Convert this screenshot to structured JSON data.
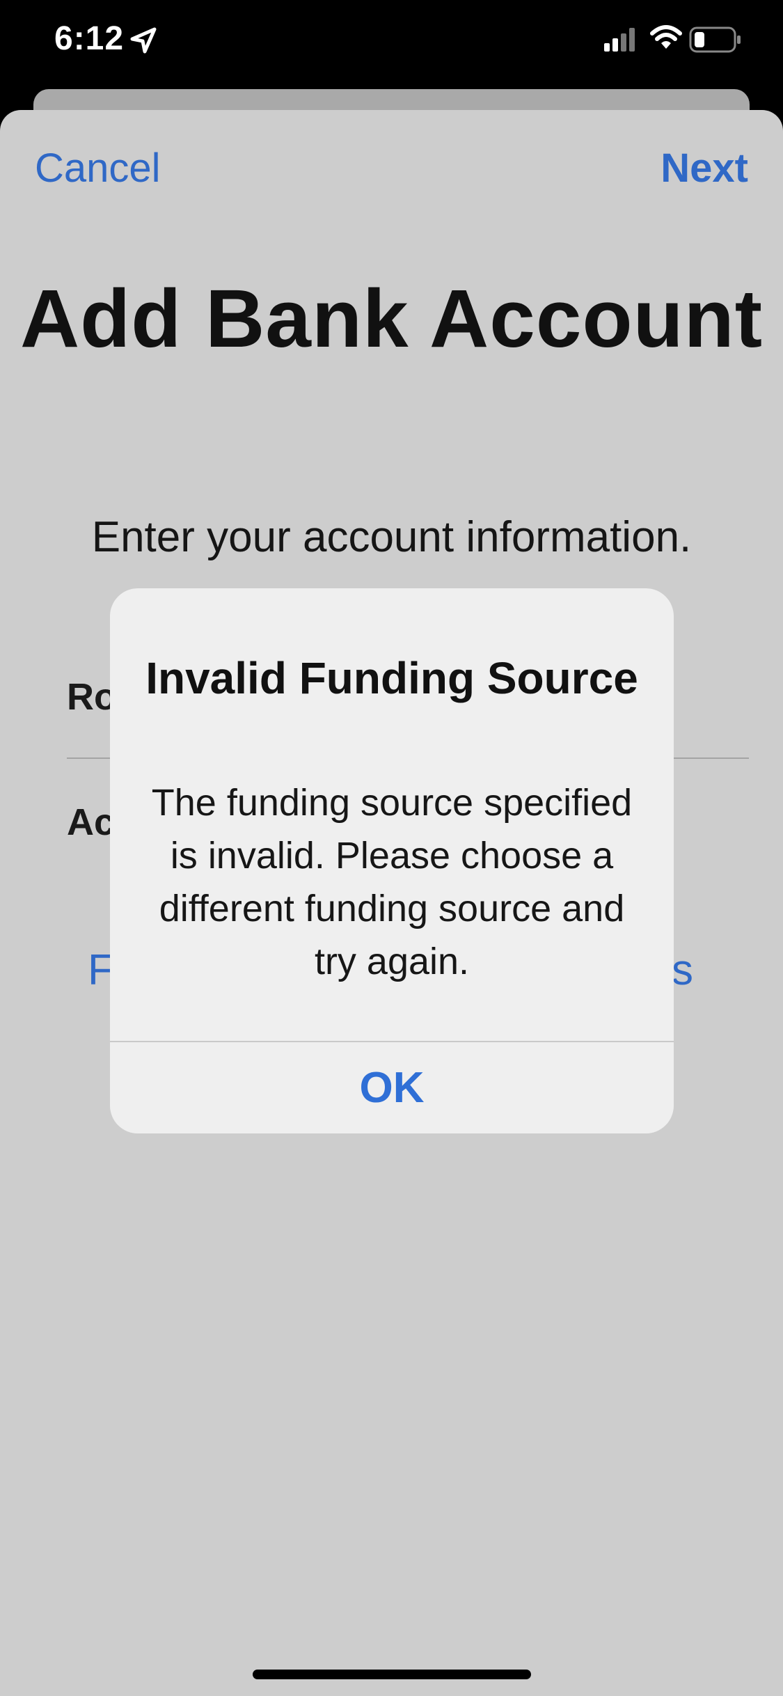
{
  "status_bar": {
    "time": "6:12",
    "icons": [
      "location-arrow-icon",
      "cellular-signal-icon",
      "wifi-icon",
      "battery-icon"
    ]
  },
  "nav": {
    "cancel_label": "Cancel",
    "next_label": "Next"
  },
  "page": {
    "title": "Add Bank Account",
    "subtitle": "Enter your account information.",
    "routing_label_visible": "Ro",
    "account_label_visible": "Ac",
    "find_link_left_visible": "F",
    "find_link_right_visible": "s"
  },
  "alert": {
    "title": "Invalid Funding Source",
    "message": "The funding source specified is invalid. Please choose a different funding source and try again.",
    "ok_label": "OK"
  },
  "colors": {
    "accent": "#2f68c6",
    "sheet_background": "#cdcdcd",
    "alert_background": "#efefef"
  }
}
